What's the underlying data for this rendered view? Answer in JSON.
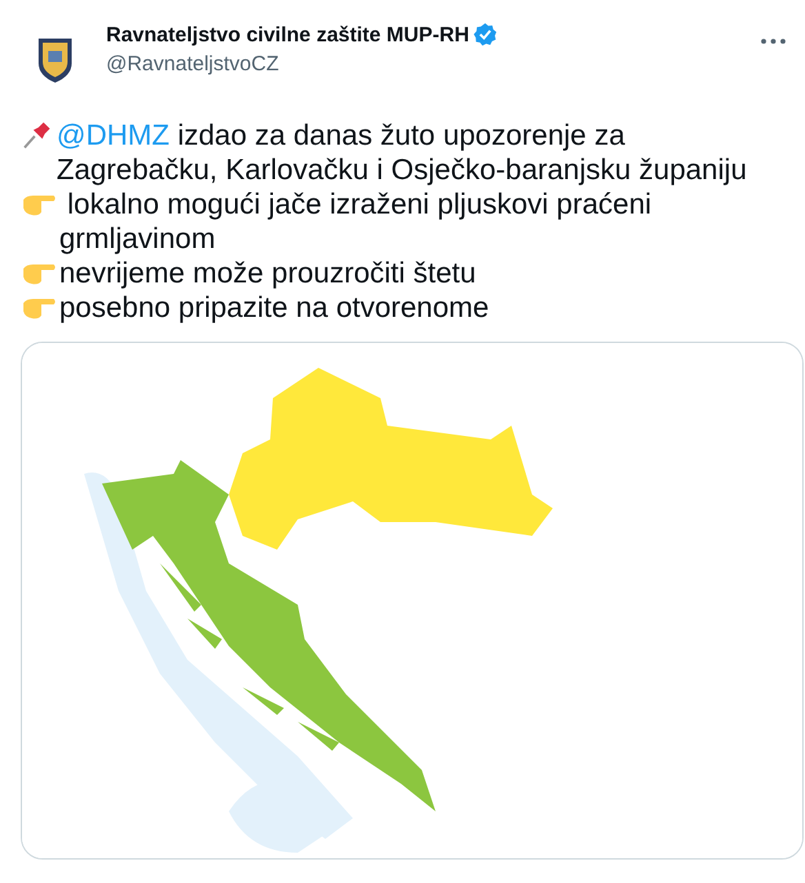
{
  "author": {
    "name": "Ravnateljstvo civilne zaštite MUP-RH",
    "verified": true,
    "handle": "@RavnateljstvoCZ"
  },
  "body": [
    {
      "kind": "pin",
      "mention": "@DHMZ",
      "text": " izdao za danas žuto upozorenje za Zagrebačku, Karlovačku i Osječko-baranjsku županiju"
    },
    {
      "kind": "hand",
      "text": " lokalno mogući jače izraženi pljuskovi praćeni grmljavinom"
    },
    {
      "kind": "hand",
      "text": "nevrijeme može prouzročiti štetu"
    },
    {
      "kind": "hand",
      "text": "posebno pripazite na otvorenome"
    }
  ]
}
